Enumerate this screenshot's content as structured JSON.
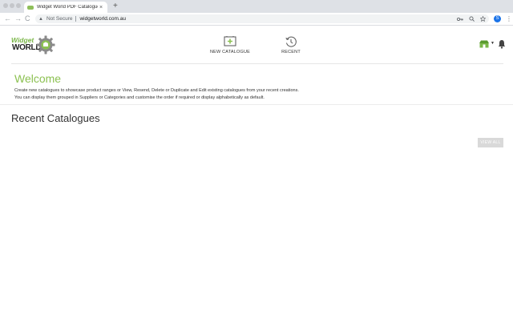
{
  "browser": {
    "tab_title": "Widget World PDF Catalogue",
    "tab_close": "×",
    "new_tab": "+",
    "back": "←",
    "forward": "→",
    "reload": "C",
    "security_icon": "▲",
    "security_label": "Not Secure",
    "url": "widgetworld.com.au",
    "profile_initial": "S",
    "icons": [
      "key-icon",
      "zoom-icon",
      "star-icon"
    ]
  },
  "brand": {
    "logo_line1": "Widget",
    "logo_line2": "WORLD",
    "accent_color": "#8cc152"
  },
  "nav": {
    "new_catalogue": "NEW CATALOGUE",
    "recent": "RECENT"
  },
  "welcome": {
    "title": "Welcome",
    "line1": "Create new catalogues to showcase product ranges or View, Resend, Delete or Duplicate and Edit existing catalogues from your recent creations.",
    "line2": "You can display them grouped in Suppliers or Categories and customise the order if required or display alphabetically as default."
  },
  "recent": {
    "title": "Recent Catalogues",
    "view_all": "VIEW ALL"
  }
}
